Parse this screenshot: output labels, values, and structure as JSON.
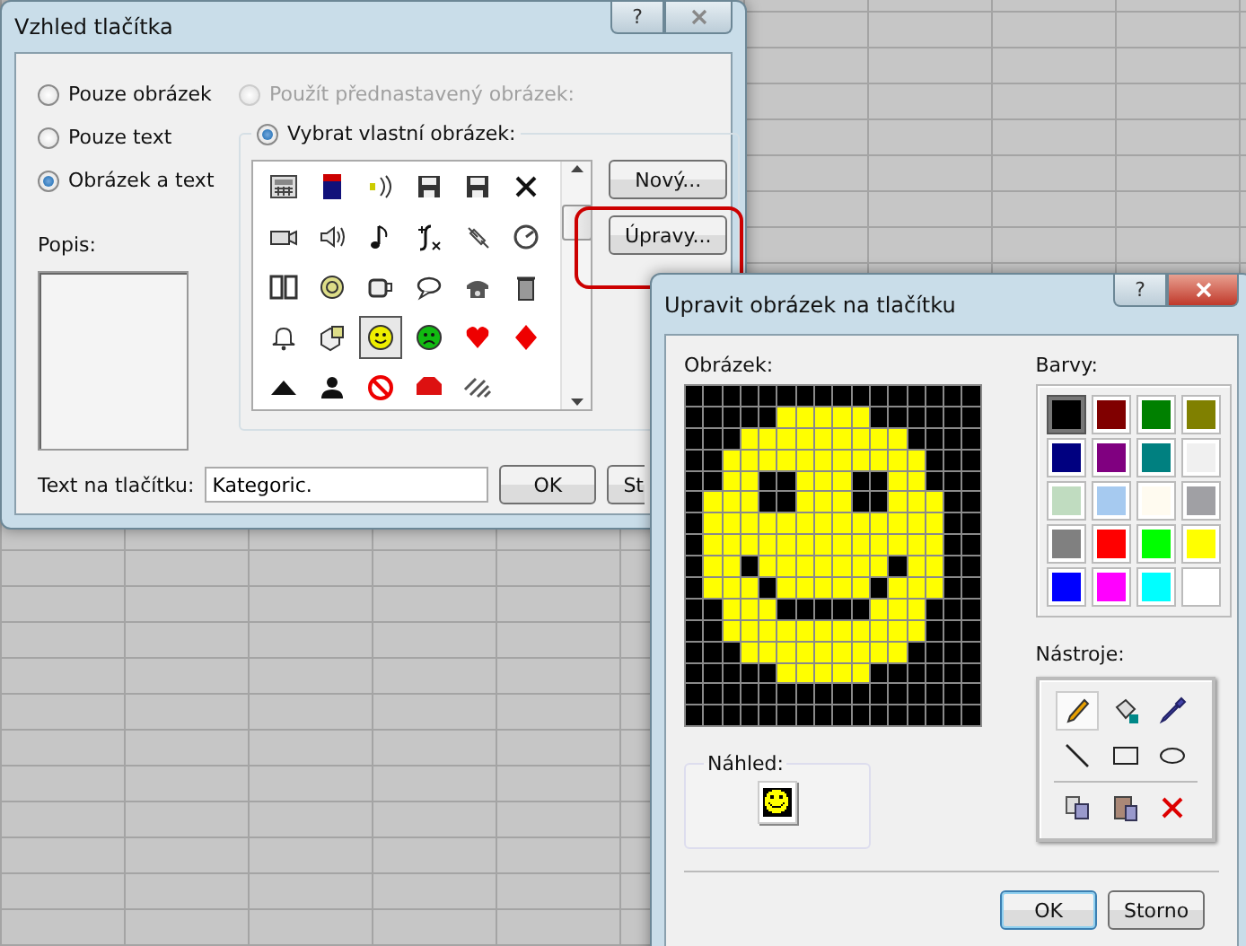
{
  "dialog": {
    "title": "Vzhled tlačítka",
    "help_button": "?",
    "display_options": [
      {
        "label": "Pouze obrázek",
        "selected": false
      },
      {
        "label": "Pouze text",
        "selected": false
      },
      {
        "label": "Obrázek a text",
        "selected": true
      }
    ],
    "description_label": "Popis:",
    "image_source": [
      {
        "label": "Použít přednastavený obrázek:",
        "selected": false,
        "disabled": true
      },
      {
        "label": "Vybrat vlastní obrázek:",
        "selected": true,
        "disabled": false
      }
    ],
    "icons": [
      {
        "selected": false
      },
      {
        "selected": false
      },
      {
        "selected": false
      },
      {
        "selected": false
      },
      {
        "selected": false
      },
      {
        "selected": false
      },
      {
        "selected": false
      },
      {
        "selected": false
      },
      {
        "selected": false
      },
      {
        "selected": false
      },
      {
        "selected": false
      },
      {
        "selected": false
      },
      {
        "selected": false
      },
      {
        "selected": false
      },
      {
        "selected": false
      },
      {
        "selected": false
      },
      {
        "selected": false
      },
      {
        "selected": false
      },
      {
        "selected": false
      },
      {
        "selected": false
      },
      {
        "selected": true
      },
      {
        "selected": false
      },
      {
        "selected": false
      },
      {
        "selected": false
      },
      {
        "selected": false
      },
      {
        "selected": false
      },
      {
        "selected": false
      },
      {
        "selected": false
      },
      {
        "selected": false
      }
    ],
    "side_buttons": [
      {
        "label": "Nový...",
        "highlighted": false
      },
      {
        "label": "Úpravy...",
        "highlighted": true
      }
    ],
    "button_text_label": "Text na tlačítku:",
    "button_text_value": "Kategoric.",
    "buttons": [
      "OK",
      "St"
    ]
  },
  "editor": {
    "title": "Upravit obrázek na tlačítku",
    "help_button": "?",
    "image_label": "Obrázek:",
    "pixels": [
      {
        "cells": [
          {
            "color": "#000000"
          },
          {
            "color": "#000000"
          },
          {
            "color": "#000000"
          },
          {
            "color": "#000000"
          },
          {
            "color": "#000000"
          },
          {
            "color": "#000000"
          },
          {
            "color": "#000000"
          },
          {
            "color": "#000000"
          },
          {
            "color": "#000000"
          },
          {
            "color": "#000000"
          },
          {
            "color": "#000000"
          },
          {
            "color": "#000000"
          },
          {
            "color": "#000000"
          },
          {
            "color": "#000000"
          },
          {
            "color": "#000000"
          },
          {
            "color": "#000000"
          }
        ]
      },
      {
        "cells": [
          {
            "color": "#000000"
          },
          {
            "color": "#000000"
          },
          {
            "color": "#000000"
          },
          {
            "color": "#000000"
          },
          {
            "color": "#000000"
          },
          {
            "color": "#ffff00"
          },
          {
            "color": "#ffff00"
          },
          {
            "color": "#ffff00"
          },
          {
            "color": "#ffff00"
          },
          {
            "color": "#ffff00"
          },
          {
            "color": "#000000"
          },
          {
            "color": "#000000"
          },
          {
            "color": "#000000"
          },
          {
            "color": "#000000"
          },
          {
            "color": "#000000"
          },
          {
            "color": "#000000"
          }
        ]
      },
      {
        "cells": [
          {
            "color": "#000000"
          },
          {
            "color": "#000000"
          },
          {
            "color": "#000000"
          },
          {
            "color": "#ffff00"
          },
          {
            "color": "#ffff00"
          },
          {
            "color": "#ffff00"
          },
          {
            "color": "#ffff00"
          },
          {
            "color": "#ffff00"
          },
          {
            "color": "#ffff00"
          },
          {
            "color": "#ffff00"
          },
          {
            "color": "#ffff00"
          },
          {
            "color": "#ffff00"
          },
          {
            "color": "#000000"
          },
          {
            "color": "#000000"
          },
          {
            "color": "#000000"
          },
          {
            "color": "#000000"
          }
        ]
      },
      {
        "cells": [
          {
            "color": "#000000"
          },
          {
            "color": "#000000"
          },
          {
            "color": "#ffff00"
          },
          {
            "color": "#ffff00"
          },
          {
            "color": "#ffff00"
          },
          {
            "color": "#ffff00"
          },
          {
            "color": "#ffff00"
          },
          {
            "color": "#ffff00"
          },
          {
            "color": "#ffff00"
          },
          {
            "color": "#ffff00"
          },
          {
            "color": "#ffff00"
          },
          {
            "color": "#ffff00"
          },
          {
            "color": "#ffff00"
          },
          {
            "color": "#000000"
          },
          {
            "color": "#000000"
          },
          {
            "color": "#000000"
          }
        ]
      },
      {
        "cells": [
          {
            "color": "#000000"
          },
          {
            "color": "#000000"
          },
          {
            "color": "#ffff00"
          },
          {
            "color": "#ffff00"
          },
          {
            "color": "#000000"
          },
          {
            "color": "#000000"
          },
          {
            "color": "#ffff00"
          },
          {
            "color": "#ffff00"
          },
          {
            "color": "#ffff00"
          },
          {
            "color": "#000000"
          },
          {
            "color": "#000000"
          },
          {
            "color": "#ffff00"
          },
          {
            "color": "#ffff00"
          },
          {
            "color": "#000000"
          },
          {
            "color": "#000000"
          },
          {
            "color": "#000000"
          }
        ]
      },
      {
        "cells": [
          {
            "color": "#000000"
          },
          {
            "color": "#ffff00"
          },
          {
            "color": "#ffff00"
          },
          {
            "color": "#ffff00"
          },
          {
            "color": "#000000"
          },
          {
            "color": "#000000"
          },
          {
            "color": "#ffff00"
          },
          {
            "color": "#ffff00"
          },
          {
            "color": "#ffff00"
          },
          {
            "color": "#000000"
          },
          {
            "color": "#000000"
          },
          {
            "color": "#ffff00"
          },
          {
            "color": "#ffff00"
          },
          {
            "color": "#ffff00"
          },
          {
            "color": "#000000"
          },
          {
            "color": "#000000"
          }
        ]
      },
      {
        "cells": [
          {
            "color": "#000000"
          },
          {
            "color": "#ffff00"
          },
          {
            "color": "#ffff00"
          },
          {
            "color": "#ffff00"
          },
          {
            "color": "#ffff00"
          },
          {
            "color": "#ffff00"
          },
          {
            "color": "#ffff00"
          },
          {
            "color": "#ffff00"
          },
          {
            "color": "#ffff00"
          },
          {
            "color": "#ffff00"
          },
          {
            "color": "#ffff00"
          },
          {
            "color": "#ffff00"
          },
          {
            "color": "#ffff00"
          },
          {
            "color": "#ffff00"
          },
          {
            "color": "#000000"
          },
          {
            "color": "#000000"
          }
        ]
      },
      {
        "cells": [
          {
            "color": "#000000"
          },
          {
            "color": "#ffff00"
          },
          {
            "color": "#ffff00"
          },
          {
            "color": "#ffff00"
          },
          {
            "color": "#ffff00"
          },
          {
            "color": "#ffff00"
          },
          {
            "color": "#ffff00"
          },
          {
            "color": "#ffff00"
          },
          {
            "color": "#ffff00"
          },
          {
            "color": "#ffff00"
          },
          {
            "color": "#ffff00"
          },
          {
            "color": "#ffff00"
          },
          {
            "color": "#ffff00"
          },
          {
            "color": "#ffff00"
          },
          {
            "color": "#000000"
          },
          {
            "color": "#000000"
          }
        ]
      },
      {
        "cells": [
          {
            "color": "#000000"
          },
          {
            "color": "#ffff00"
          },
          {
            "color": "#ffff00"
          },
          {
            "color": "#000000"
          },
          {
            "color": "#ffff00"
          },
          {
            "color": "#ffff00"
          },
          {
            "color": "#ffff00"
          },
          {
            "color": "#ffff00"
          },
          {
            "color": "#ffff00"
          },
          {
            "color": "#ffff00"
          },
          {
            "color": "#ffff00"
          },
          {
            "color": "#000000"
          },
          {
            "color": "#ffff00"
          },
          {
            "color": "#ffff00"
          },
          {
            "color": "#000000"
          },
          {
            "color": "#000000"
          }
        ]
      },
      {
        "cells": [
          {
            "color": "#000000"
          },
          {
            "color": "#ffff00"
          },
          {
            "color": "#ffff00"
          },
          {
            "color": "#ffff00"
          },
          {
            "color": "#000000"
          },
          {
            "color": "#ffff00"
          },
          {
            "color": "#ffff00"
          },
          {
            "color": "#ffff00"
          },
          {
            "color": "#ffff00"
          },
          {
            "color": "#ffff00"
          },
          {
            "color": "#000000"
          },
          {
            "color": "#ffff00"
          },
          {
            "color": "#ffff00"
          },
          {
            "color": "#ffff00"
          },
          {
            "color": "#000000"
          },
          {
            "color": "#000000"
          }
        ]
      },
      {
        "cells": [
          {
            "color": "#000000"
          },
          {
            "color": "#000000"
          },
          {
            "color": "#ffff00"
          },
          {
            "color": "#ffff00"
          },
          {
            "color": "#ffff00"
          },
          {
            "color": "#000000"
          },
          {
            "color": "#000000"
          },
          {
            "color": "#000000"
          },
          {
            "color": "#000000"
          },
          {
            "color": "#000000"
          },
          {
            "color": "#ffff00"
          },
          {
            "color": "#ffff00"
          },
          {
            "color": "#ffff00"
          },
          {
            "color": "#000000"
          },
          {
            "color": "#000000"
          },
          {
            "color": "#000000"
          }
        ]
      },
      {
        "cells": [
          {
            "color": "#000000"
          },
          {
            "color": "#000000"
          },
          {
            "color": "#ffff00"
          },
          {
            "color": "#ffff00"
          },
          {
            "color": "#ffff00"
          },
          {
            "color": "#ffff00"
          },
          {
            "color": "#ffff00"
          },
          {
            "color": "#ffff00"
          },
          {
            "color": "#ffff00"
          },
          {
            "color": "#ffff00"
          },
          {
            "color": "#ffff00"
          },
          {
            "color": "#ffff00"
          },
          {
            "color": "#ffff00"
          },
          {
            "color": "#000000"
          },
          {
            "color": "#000000"
          },
          {
            "color": "#000000"
          }
        ]
      },
      {
        "cells": [
          {
            "color": "#000000"
          },
          {
            "color": "#000000"
          },
          {
            "color": "#000000"
          },
          {
            "color": "#ffff00"
          },
          {
            "color": "#ffff00"
          },
          {
            "color": "#ffff00"
          },
          {
            "color": "#ffff00"
          },
          {
            "color": "#ffff00"
          },
          {
            "color": "#ffff00"
          },
          {
            "color": "#ffff00"
          },
          {
            "color": "#ffff00"
          },
          {
            "color": "#ffff00"
          },
          {
            "color": "#000000"
          },
          {
            "color": "#000000"
          },
          {
            "color": "#000000"
          },
          {
            "color": "#000000"
          }
        ]
      },
      {
        "cells": [
          {
            "color": "#000000"
          },
          {
            "color": "#000000"
          },
          {
            "color": "#000000"
          },
          {
            "color": "#000000"
          },
          {
            "color": "#000000"
          },
          {
            "color": "#ffff00"
          },
          {
            "color": "#ffff00"
          },
          {
            "color": "#ffff00"
          },
          {
            "color": "#ffff00"
          },
          {
            "color": "#ffff00"
          },
          {
            "color": "#000000"
          },
          {
            "color": "#000000"
          },
          {
            "color": "#000000"
          },
          {
            "color": "#000000"
          },
          {
            "color": "#000000"
          },
          {
            "color": "#000000"
          }
        ]
      },
      {
        "cells": [
          {
            "color": "#000000"
          },
          {
            "color": "#000000"
          },
          {
            "color": "#000000"
          },
          {
            "color": "#000000"
          },
          {
            "color": "#000000"
          },
          {
            "color": "#000000"
          },
          {
            "color": "#000000"
          },
          {
            "color": "#000000"
          },
          {
            "color": "#000000"
          },
          {
            "color": "#000000"
          },
          {
            "color": "#000000"
          },
          {
            "color": "#000000"
          },
          {
            "color": "#000000"
          },
          {
            "color": "#000000"
          },
          {
            "color": "#000000"
          },
          {
            "color": "#000000"
          }
        ]
      },
      {
        "cells": [
          {
            "color": "#000000"
          },
          {
            "color": "#000000"
          },
          {
            "color": "#000000"
          },
          {
            "color": "#000000"
          },
          {
            "color": "#000000"
          },
          {
            "color": "#000000"
          },
          {
            "color": "#000000"
          },
          {
            "color": "#000000"
          },
          {
            "color": "#000000"
          },
          {
            "color": "#000000"
          },
          {
            "color": "#000000"
          },
          {
            "color": "#000000"
          },
          {
            "color": "#000000"
          },
          {
            "color": "#000000"
          },
          {
            "color": "#000000"
          },
          {
            "color": "#000000"
          }
        ]
      }
    ],
    "colors_label": "Barvy:",
    "palette": [
      {
        "color": "#000000",
        "selected": true
      },
      {
        "color": "#800000",
        "selected": false
      },
      {
        "color": "#008000",
        "selected": false
      },
      {
        "color": "#808000",
        "selected": false
      },
      {
        "color": "#000080",
        "selected": false
      },
      {
        "color": "#800080",
        "selected": false
      },
      {
        "color": "#008080",
        "selected": false
      },
      {
        "color": "#f0f0f0",
        "selected": false
      },
      {
        "color": "#c0dcc0",
        "selected": false
      },
      {
        "color": "#a6caf0",
        "selected": false
      },
      {
        "color": "#fffbf0",
        "selected": false
      },
      {
        "color": "#a0a0a4",
        "selected": false
      },
      {
        "color": "#808080",
        "selected": false
      },
      {
        "color": "#ff0000",
        "selected": false
      },
      {
        "color": "#00ff00",
        "selected": false
      },
      {
        "color": "#ffff00",
        "selected": false
      },
      {
        "color": "#0000ff",
        "selected": false
      },
      {
        "color": "#ff00ff",
        "selected": false
      },
      {
        "color": "#00ffff",
        "selected": false
      },
      {
        "color": "#ffffff",
        "selected": false
      }
    ],
    "tools_label": "Nástroje:",
    "tools": [
      {
        "selected": true
      },
      {
        "selected": false
      },
      {
        "selected": false
      },
      {
        "selected": false
      },
      {
        "selected": false
      },
      {
        "selected": false
      },
      {
        "selected": false
      },
      {
        "selected": false
      },
      {
        "selected": false
      }
    ],
    "preview_label": "Náhled:",
    "buttons": [
      "OK",
      "Storno"
    ]
  }
}
